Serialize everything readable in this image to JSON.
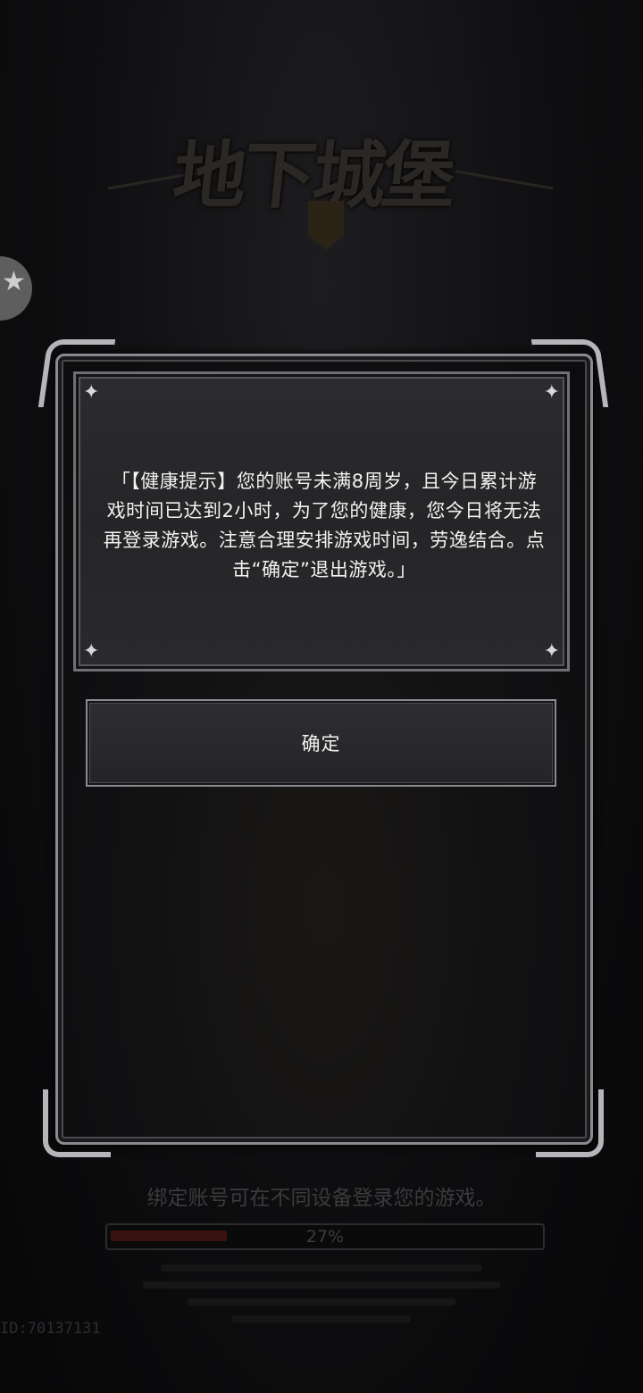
{
  "background": {
    "logo_text": "地下城堡",
    "icon": "castle-emblem-icon"
  },
  "floating_button": {
    "icon": "assistant-star-icon",
    "glyph": "★"
  },
  "dialog": {
    "message": "「【健康提示】您的账号未满8周岁，且今日累计游戏时间已达到2小时，为了您的健康，您今日将无法再登录游戏。注意合理安排游戏时间，劳逸结合。点击“确定”退出游戏。」",
    "corner_glyph": "✦",
    "confirm_label": "确定"
  },
  "loading": {
    "tip": "绑定账号可在不同设备登录您的游戏。",
    "progress_label": "27%",
    "progress_fraction": 0.27
  },
  "footer": {
    "user_id": "ID:70137131"
  },
  "colors": {
    "panel": "#2a2a2c",
    "border": "#8a8a8f",
    "text": "#f2f2f2",
    "progress_fill": "#3a1111"
  }
}
